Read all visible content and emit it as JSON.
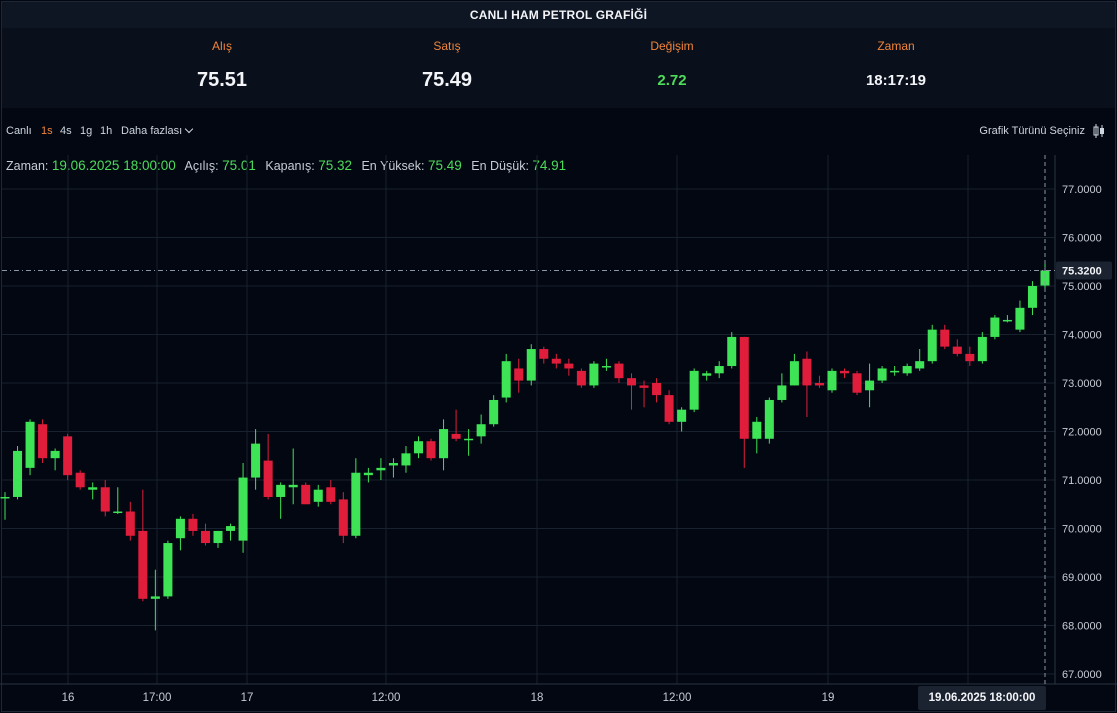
{
  "title": "CANLI HAM PETROL GRAFİĞİ",
  "quotes": [
    {
      "label": "Alış",
      "value": "75.51"
    },
    {
      "label": "Satış",
      "value": "75.49"
    },
    {
      "label": "Değişim",
      "value": "2.72"
    },
    {
      "label": "Zaman",
      "value": "18:17:19"
    }
  ],
  "toolbar": {
    "live": "Canlı",
    "intervals": [
      "1s",
      "4s",
      "1g",
      "1h"
    ],
    "active_interval": "1s",
    "more": "Daha fazlası",
    "chart_type": "Grafik Türünü Seçiniz"
  },
  "ohlc": {
    "time_label": "Zaman:",
    "time": "19.06.2025 18:00:00",
    "open_label": "Açılış:",
    "open": "75.01",
    "close_label": "Kapanış:",
    "close": "75.32",
    "high_label": "En Yüksek:",
    "high": "75.49",
    "low_label": "En Düşük:",
    "low": "74.91"
  },
  "colors": {
    "up": "#3ee456",
    "down": "#e01e3c",
    "accent": "#f0843a",
    "background": "#020712"
  },
  "chart_data": {
    "type": "candlestick",
    "ylim": [
      67.0,
      77.0
    ],
    "y_ticks": [
      "77.0000",
      "76.0000",
      "75.0000",
      "74.0000",
      "73.0000",
      "72.0000",
      "71.0000",
      "70.0000",
      "69.0000",
      "68.0000",
      "67.0000"
    ],
    "x_ticks": [
      "16",
      "17:00",
      "17",
      "12:00",
      "18",
      "12:00",
      "19"
    ],
    "last_price": "75.3200",
    "crosshair_time": "19.06.2025  18:00:00",
    "grid": true,
    "candles": [
      {
        "o": 70.65,
        "h": 70.75,
        "l": 70.18,
        "c": 70.65
      },
      {
        "o": 70.65,
        "h": 71.7,
        "l": 70.6,
        "c": 71.6
      },
      {
        "o": 71.25,
        "h": 72.25,
        "l": 71.1,
        "c": 72.2
      },
      {
        "o": 72.15,
        "h": 72.25,
        "l": 71.35,
        "c": 71.45
      },
      {
        "o": 71.45,
        "h": 71.65,
        "l": 71.2,
        "c": 71.6
      },
      {
        "o": 71.9,
        "h": 71.95,
        "l": 71.0,
        "c": 71.1
      },
      {
        "o": 71.15,
        "h": 71.2,
        "l": 70.8,
        "c": 70.85
      },
      {
        "o": 70.8,
        "h": 70.95,
        "l": 70.6,
        "c": 70.85
      },
      {
        "o": 70.85,
        "h": 71.0,
        "l": 70.25,
        "c": 70.35
      },
      {
        "o": 70.35,
        "h": 70.85,
        "l": 70.3,
        "c": 70.35
      },
      {
        "o": 70.35,
        "h": 70.55,
        "l": 69.75,
        "c": 69.85
      },
      {
        "o": 69.95,
        "h": 70.8,
        "l": 68.5,
        "c": 68.55
      },
      {
        "o": 68.55,
        "h": 69.15,
        "l": 67.9,
        "c": 68.6
      },
      {
        "o": 68.6,
        "h": 69.75,
        "l": 68.55,
        "c": 69.7
      },
      {
        "o": 69.8,
        "h": 70.25,
        "l": 69.55,
        "c": 70.2
      },
      {
        "o": 70.2,
        "h": 70.3,
        "l": 69.85,
        "c": 69.95
      },
      {
        "o": 69.95,
        "h": 70.1,
        "l": 69.65,
        "c": 69.7
      },
      {
        "o": 69.7,
        "h": 69.95,
        "l": 69.6,
        "c": 69.95
      },
      {
        "o": 69.95,
        "h": 70.1,
        "l": 69.75,
        "c": 70.05
      },
      {
        "o": 69.75,
        "h": 71.35,
        "l": 69.5,
        "c": 71.05
      },
      {
        "o": 71.05,
        "h": 72.05,
        "l": 70.8,
        "c": 71.75
      },
      {
        "o": 71.4,
        "h": 71.95,
        "l": 70.6,
        "c": 70.65
      },
      {
        "o": 70.65,
        "h": 70.95,
        "l": 70.2,
        "c": 70.9
      },
      {
        "o": 70.85,
        "h": 71.65,
        "l": 70.5,
        "c": 70.9
      },
      {
        "o": 70.9,
        "h": 70.95,
        "l": 70.5,
        "c": 70.5
      },
      {
        "o": 70.55,
        "h": 70.9,
        "l": 70.45,
        "c": 70.8
      },
      {
        "o": 70.85,
        "h": 71.0,
        "l": 70.5,
        "c": 70.55
      },
      {
        "o": 70.6,
        "h": 70.75,
        "l": 69.7,
        "c": 69.85
      },
      {
        "o": 69.85,
        "h": 71.45,
        "l": 69.8,
        "c": 71.15
      },
      {
        "o": 71.1,
        "h": 71.25,
        "l": 70.95,
        "c": 71.15
      },
      {
        "o": 71.2,
        "h": 71.45,
        "l": 71.0,
        "c": 71.25
      },
      {
        "o": 71.3,
        "h": 71.45,
        "l": 71.05,
        "c": 71.35
      },
      {
        "o": 71.3,
        "h": 71.7,
        "l": 71.15,
        "c": 71.55
      },
      {
        "o": 71.55,
        "h": 71.9,
        "l": 71.45,
        "c": 71.8
      },
      {
        "o": 71.8,
        "h": 71.85,
        "l": 71.4,
        "c": 71.45
      },
      {
        "o": 71.45,
        "h": 72.25,
        "l": 71.2,
        "c": 72.05
      },
      {
        "o": 71.95,
        "h": 72.45,
        "l": 71.8,
        "c": 71.85
      },
      {
        "o": 71.85,
        "h": 72.05,
        "l": 71.5,
        "c": 71.85
      },
      {
        "o": 71.9,
        "h": 72.35,
        "l": 71.75,
        "c": 72.15
      },
      {
        "o": 72.15,
        "h": 72.75,
        "l": 72.1,
        "c": 72.65
      },
      {
        "o": 72.7,
        "h": 73.6,
        "l": 72.6,
        "c": 73.45
      },
      {
        "o": 73.3,
        "h": 73.5,
        "l": 72.8,
        "c": 73.05
      },
      {
        "o": 73.05,
        "h": 73.8,
        "l": 72.95,
        "c": 73.7
      },
      {
        "o": 73.7,
        "h": 73.75,
        "l": 73.4,
        "c": 73.5
      },
      {
        "o": 73.5,
        "h": 73.6,
        "l": 73.3,
        "c": 73.4
      },
      {
        "o": 73.4,
        "h": 73.5,
        "l": 73.15,
        "c": 73.3
      },
      {
        "o": 73.25,
        "h": 73.3,
        "l": 72.9,
        "c": 72.95
      },
      {
        "o": 72.95,
        "h": 73.45,
        "l": 72.9,
        "c": 73.4
      },
      {
        "o": 73.35,
        "h": 73.5,
        "l": 73.25,
        "c": 73.35
      },
      {
        "o": 73.4,
        "h": 73.45,
        "l": 73.0,
        "c": 73.1
      },
      {
        "o": 73.1,
        "h": 73.2,
        "l": 72.45,
        "c": 72.95
      },
      {
        "o": 72.95,
        "h": 73.05,
        "l": 72.5,
        "c": 72.9
      },
      {
        "o": 73.0,
        "h": 73.1,
        "l": 72.6,
        "c": 72.75
      },
      {
        "o": 72.75,
        "h": 72.85,
        "l": 72.15,
        "c": 72.2
      },
      {
        "o": 72.2,
        "h": 72.5,
        "l": 72.0,
        "c": 72.45
      },
      {
        "o": 72.45,
        "h": 73.3,
        "l": 72.4,
        "c": 73.25
      },
      {
        "o": 73.15,
        "h": 73.25,
        "l": 73.05,
        "c": 73.2
      },
      {
        "o": 73.2,
        "h": 73.45,
        "l": 73.1,
        "c": 73.35
      },
      {
        "o": 73.35,
        "h": 74.05,
        "l": 73.3,
        "c": 73.95
      },
      {
        "o": 73.95,
        "h": 73.95,
        "l": 71.25,
        "c": 71.85
      },
      {
        "o": 71.85,
        "h": 72.3,
        "l": 71.55,
        "c": 72.2
      },
      {
        "o": 71.85,
        "h": 72.7,
        "l": 71.75,
        "c": 72.65
      },
      {
        "o": 72.65,
        "h": 73.2,
        "l": 72.6,
        "c": 72.95
      },
      {
        "o": 72.95,
        "h": 73.6,
        "l": 72.95,
        "c": 73.45
      },
      {
        "o": 73.5,
        "h": 73.65,
        "l": 72.3,
        "c": 72.95
      },
      {
        "o": 73.0,
        "h": 73.15,
        "l": 72.9,
        "c": 72.95
      },
      {
        "o": 72.85,
        "h": 73.3,
        "l": 72.8,
        "c": 73.25
      },
      {
        "o": 73.25,
        "h": 73.3,
        "l": 73.1,
        "c": 73.2
      },
      {
        "o": 73.2,
        "h": 73.25,
        "l": 72.75,
        "c": 72.8
      },
      {
        "o": 72.85,
        "h": 73.4,
        "l": 72.5,
        "c": 73.05
      },
      {
        "o": 73.05,
        "h": 73.35,
        "l": 73.0,
        "c": 73.3
      },
      {
        "o": 73.25,
        "h": 73.35,
        "l": 73.15,
        "c": 73.25
      },
      {
        "o": 73.2,
        "h": 73.4,
        "l": 73.15,
        "c": 73.35
      },
      {
        "o": 73.3,
        "h": 73.7,
        "l": 73.25,
        "c": 73.45
      },
      {
        "o": 73.45,
        "h": 74.2,
        "l": 73.4,
        "c": 74.1
      },
      {
        "o": 74.1,
        "h": 74.2,
        "l": 73.7,
        "c": 73.75
      },
      {
        "o": 73.75,
        "h": 73.9,
        "l": 73.55,
        "c": 73.6
      },
      {
        "o": 73.6,
        "h": 73.75,
        "l": 73.35,
        "c": 73.45
      },
      {
        "o": 73.45,
        "h": 74.05,
        "l": 73.4,
        "c": 73.95
      },
      {
        "o": 73.95,
        "h": 74.4,
        "l": 73.9,
        "c": 74.35
      },
      {
        "o": 74.3,
        "h": 74.4,
        "l": 74.25,
        "c": 74.3
      },
      {
        "o": 74.1,
        "h": 74.7,
        "l": 74.05,
        "c": 74.55
      },
      {
        "o": 74.55,
        "h": 75.1,
        "l": 74.4,
        "c": 75.0
      },
      {
        "o": 75.01,
        "h": 75.49,
        "l": 74.91,
        "c": 75.32
      }
    ]
  }
}
